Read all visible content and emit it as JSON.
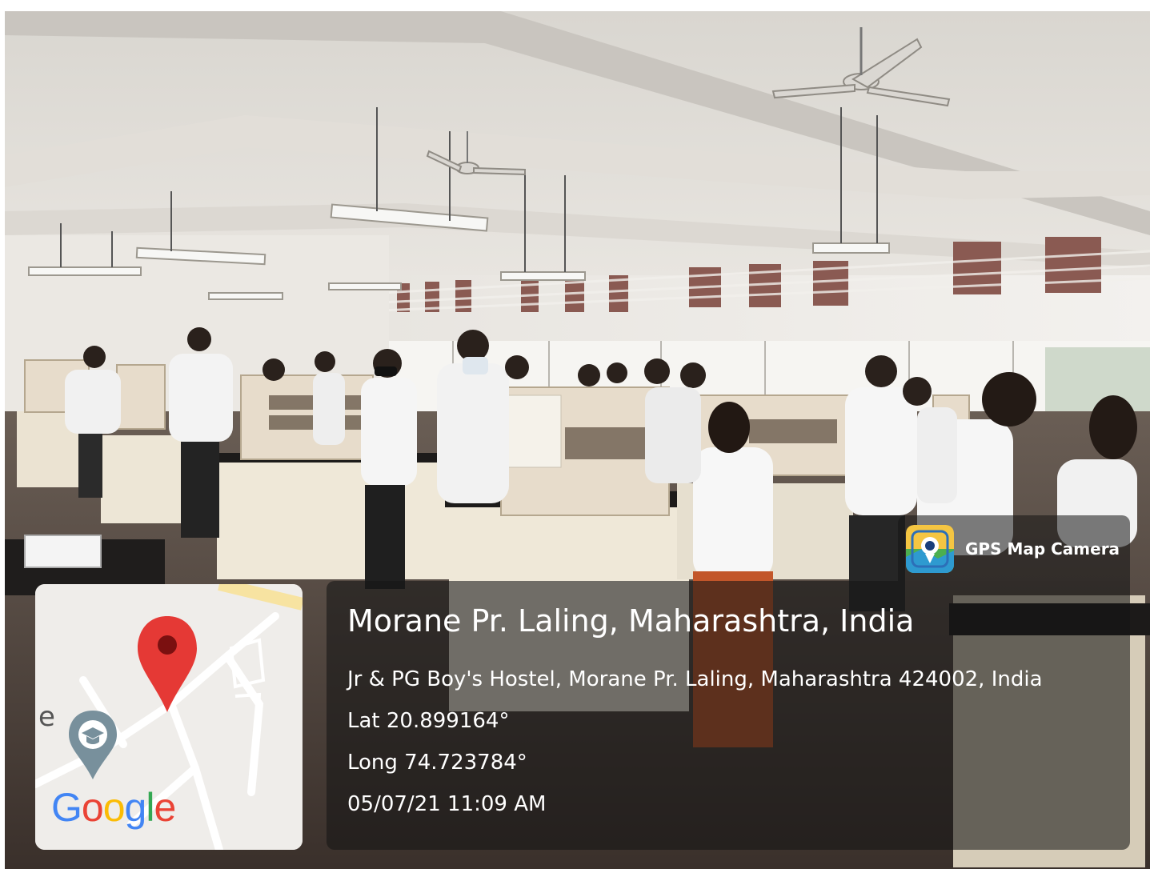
{
  "overlay": {
    "app_name": "GPS Map Camera",
    "app_icon": "map-camera-icon",
    "place_title": "Morane Pr. Laling, Maharashtra, India",
    "address": "Jr & PG Boy's Hostel, Morane Pr. Laling, Maharashtra 424002, India",
    "latitude": "Lat 20.899164°",
    "longitude": "Long 74.723784°",
    "datetime": "05/07/21 11:09 AM"
  },
  "map": {
    "logo_text": "Google",
    "logo_letters": [
      {
        "ch": "G",
        "color": "#4285F4"
      },
      {
        "ch": "o",
        "color": "#EA4335"
      },
      {
        "ch": "o",
        "color": "#FBBC05"
      },
      {
        "ch": "g",
        "color": "#4285F4"
      },
      {
        "ch": "l",
        "color": "#34A853"
      },
      {
        "ch": "e",
        "color": "#EA4335"
      }
    ],
    "edge_letter": "e",
    "pin_icon": "location-pin-icon",
    "poi_icon": "graduation-cap-icon",
    "pin_color": "#E53935",
    "poi_color": "#78909C"
  }
}
